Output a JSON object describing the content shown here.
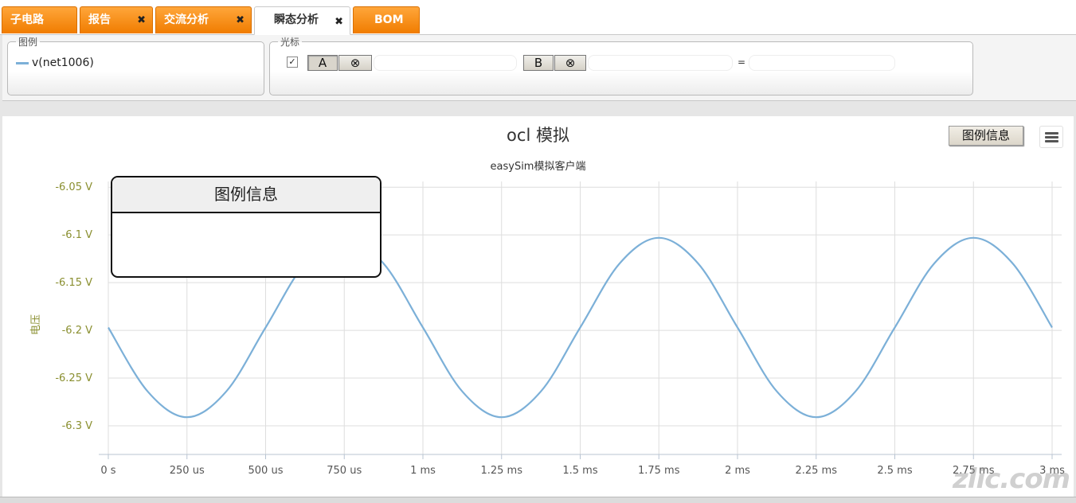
{
  "tabs": [
    {
      "label": "子电路",
      "closable": false,
      "active": false
    },
    {
      "label": "报告",
      "closable": true,
      "active": false
    },
    {
      "label": "交流分析",
      "closable": true,
      "active": false
    },
    {
      "label": "瞬态分析",
      "closable": true,
      "active": true
    },
    {
      "label": "BOM",
      "closable": false,
      "active": false
    }
  ],
  "toolbar": {
    "legend_title": "图例",
    "legend_series": "v(net1006)",
    "cursor_title": "光标",
    "cursor_checkbox": "✓",
    "cursor_a_label": "A",
    "cursor_b_label": "B",
    "remove_symbol": "⊗",
    "equals": "="
  },
  "chart": {
    "legend_info_button": "图例信息",
    "popup_title": "图例信息"
  },
  "chart_data": {
    "type": "line",
    "title": "ocl 模拟",
    "subtitle": "easySim模拟客户端",
    "ylabel": "电压",
    "xlabel": "",
    "xlim": [
      0,
      3
    ],
    "ylim": [
      -6.33,
      -6.044
    ],
    "x_ticks": [
      0,
      0.25,
      0.5,
      0.75,
      1,
      1.25,
      1.5,
      1.75,
      2,
      2.25,
      2.5,
      2.75,
      3
    ],
    "x_tick_labels": [
      "0 s",
      "250 us",
      "500 us",
      "750 us",
      "1 ms",
      "1.25 ms",
      "1.5 ms",
      "1.75 ms",
      "2 ms",
      "2.25 ms",
      "2.5 ms",
      "2.75 ms",
      "3 ms"
    ],
    "y_ticks": [
      -6.05,
      -6.1,
      -6.15,
      -6.2,
      -6.25,
      -6.3
    ],
    "y_tick_labels": [
      "-6.05 V",
      "-6.1 V",
      "-6.15 V",
      "-6.2 V",
      "-6.25 V",
      "-6.3 V"
    ],
    "grid": true,
    "series": [
      {
        "name": "v(net1006)",
        "color": "#7cb0d8",
        "x": [
          0,
          0.125,
          0.25,
          0.375,
          0.5,
          0.625,
          0.75,
          0.875,
          1,
          1.125,
          1.25,
          1.375,
          1.5,
          1.625,
          1.75,
          1.875,
          2,
          2.125,
          2.25,
          2.375,
          2.5,
          2.625,
          2.75,
          2.875,
          3
        ],
        "y": [
          -6.197,
          -6.264,
          -6.291,
          -6.264,
          -6.197,
          -6.13,
          -6.103,
          -6.13,
          -6.197,
          -6.264,
          -6.291,
          -6.264,
          -6.197,
          -6.13,
          -6.103,
          -6.13,
          -6.197,
          -6.264,
          -6.291,
          -6.264,
          -6.197,
          -6.13,
          -6.103,
          -6.13,
          -6.197
        ]
      }
    ]
  },
  "watermark": "zlic.com"
}
